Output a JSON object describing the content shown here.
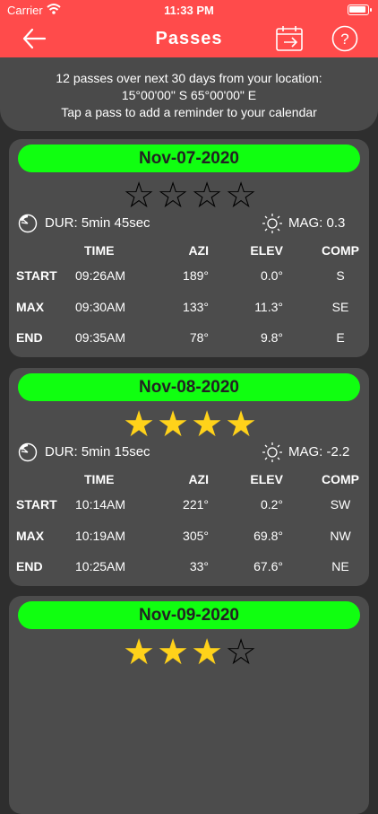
{
  "status": {
    "carrier": "Carrier",
    "time": "11:33 PM"
  },
  "nav": {
    "title": "Passes"
  },
  "info": {
    "line1": "12 passes over next 30 days from your location:",
    "line2": "15°00'00\" S   65°00'00\" E",
    "line3": "Tap a pass to add a reminder to your calendar"
  },
  "headers": [
    "TIME",
    "AZI",
    "ELEV",
    "COMP"
  ],
  "colors": {
    "accent": "#ff4b4b",
    "date_pill": "#10ff10",
    "star_on": "#ffd21a",
    "star_off": "#111111"
  },
  "passes": [
    {
      "date": "Nov-07-2020",
      "rating": 0,
      "stars_max": 4,
      "duration": "DUR: 5min 45sec",
      "magnitude": "MAG: 0.3",
      "rows": [
        {
          "label": "START",
          "time": "09:26AM",
          "azi": "189°",
          "elev": "0.0°",
          "comp": "S"
        },
        {
          "label": "MAX",
          "time": "09:30AM",
          "azi": "133°",
          "elev": "11.3°",
          "comp": "SE"
        },
        {
          "label": "END",
          "time": "09:35AM",
          "azi": "78°",
          "elev": "9.8°",
          "comp": "E"
        }
      ]
    },
    {
      "date": "Nov-08-2020",
      "rating": 4,
      "stars_max": 4,
      "duration": "DUR: 5min 15sec",
      "magnitude": "MAG: -2.2",
      "rows": [
        {
          "label": "START",
          "time": "10:14AM",
          "azi": "221°",
          "elev": "0.2°",
          "comp": "SW"
        },
        {
          "label": "MAX",
          "time": "10:19AM",
          "azi": "305°",
          "elev": "69.8°",
          "comp": "NW"
        },
        {
          "label": "END",
          "time": "10:25AM",
          "azi": "33°",
          "elev": "67.6°",
          "comp": "NE"
        }
      ]
    },
    {
      "date": "Nov-09-2020",
      "rating": 3,
      "stars_max": 4
    }
  ]
}
